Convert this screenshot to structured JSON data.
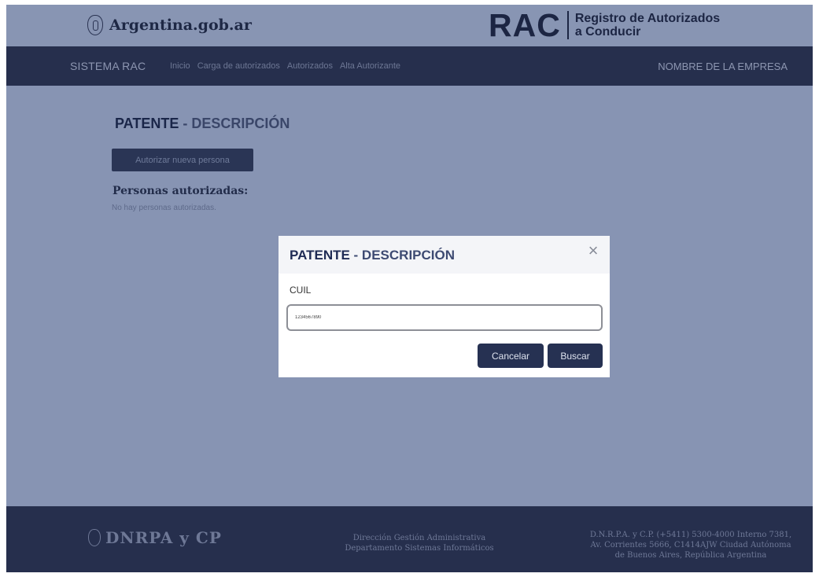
{
  "header": {
    "gov_site": "Argentina.gob.ar",
    "rac_logo": "RAC",
    "rac_subtitle_line1": "Registro de Autorizados",
    "rac_subtitle_line2": "a Conducir"
  },
  "navbar": {
    "brand": "SISTEMA RAC",
    "links": [
      "Inicio",
      "Carga de autorizados",
      "Autorizados",
      "Alta Autorizante"
    ],
    "company": "NOMBRE DE LA EMPRESA"
  },
  "main": {
    "title_patente": "PATENTE",
    "title_desc": " - DESCRIPCIÓN",
    "new_person_button": "Autorizar nueva persona",
    "authorized_heading": "Personas autorizadas:",
    "empty_message": "No hay personas autorizadas."
  },
  "modal": {
    "title_patente": "PATENTE",
    "title_desc": " - DESCRIPCIÓN",
    "close_glyph": "×",
    "field_label": "CUIL",
    "field_value": "1234567890",
    "cancel_label": "Cancelar",
    "search_label": "Buscar"
  },
  "footer": {
    "logo_name": "DNRPA y CP",
    "middle_line1": "Dirección Gestión Administrativa",
    "middle_line2": "Departamento Sistemas Informáticos",
    "right_line1": "D.N.R.P.A. y C.P. (+5411) 5300-4000 Interno 7381,",
    "right_line2": "Av. Corrientes 5666, C1414AJW Ciudad Autónoma",
    "right_line3": "de Buenos Aires, República Argentina"
  },
  "colors": {
    "navy": "#262f4d",
    "overlay_blue": "#8794b3",
    "modal_button": "#263152"
  }
}
